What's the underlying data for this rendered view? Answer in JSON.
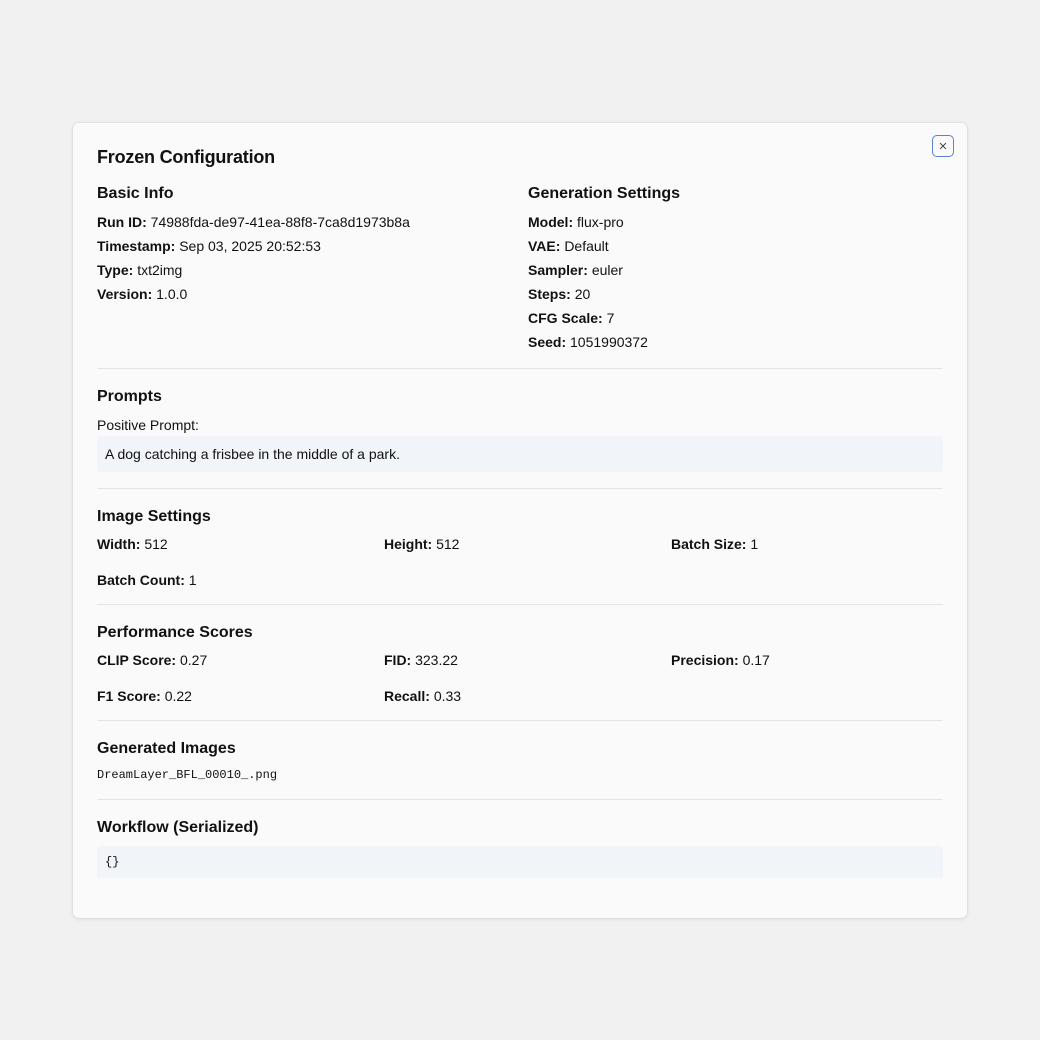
{
  "modal": {
    "title": "Frozen Configuration",
    "close_icon": "close-icon"
  },
  "basic_info": {
    "title": "Basic Info",
    "items": [
      {
        "label": "Run ID:",
        "value": "74988fda-de97-41ea-88f8-7ca8d1973b8a"
      },
      {
        "label": "Timestamp:",
        "value": "Sep 03, 2025 20:52:53"
      },
      {
        "label": "Type:",
        "value": "txt2img"
      },
      {
        "label": "Version:",
        "value": "1.0.0"
      }
    ]
  },
  "generation_settings": {
    "title": "Generation Settings",
    "items": [
      {
        "label": "Model:",
        "value": "flux-pro"
      },
      {
        "label": "VAE:",
        "value": "Default"
      },
      {
        "label": "Sampler:",
        "value": "euler"
      },
      {
        "label": "Steps:",
        "value": "20"
      },
      {
        "label": "CFG Scale:",
        "value": "7"
      },
      {
        "label": "Seed:",
        "value": "1051990372"
      }
    ]
  },
  "prompts": {
    "title": "Prompts",
    "positive_label": "Positive Prompt:",
    "positive_value": "A dog catching a frisbee in the middle of a park."
  },
  "image_settings": {
    "title": "Image Settings",
    "items": [
      {
        "label": "Width:",
        "value": "512"
      },
      {
        "label": "Height:",
        "value": "512"
      },
      {
        "label": "Batch Size:",
        "value": "1"
      },
      {
        "label": "Batch Count:",
        "value": "1"
      }
    ]
  },
  "performance": {
    "title": "Performance Scores",
    "items": [
      {
        "label": "CLIP Score:",
        "value": "0.27"
      },
      {
        "label": "FID:",
        "value": "323.22"
      },
      {
        "label": "Precision:",
        "value": "0.17"
      },
      {
        "label": "F1 Score:",
        "value": "0.22"
      },
      {
        "label": "Recall:",
        "value": "0.33"
      }
    ]
  },
  "generated_images": {
    "title": "Generated Images",
    "files": [
      "DreamLayer_BFL_00010_.png"
    ]
  },
  "workflow": {
    "title": "Workflow (Serialized)",
    "value": "{}"
  },
  "colors": {
    "accent": "#5b7fd6",
    "box_bg": "#f1f4f8",
    "divider": "#e4e4e4"
  }
}
